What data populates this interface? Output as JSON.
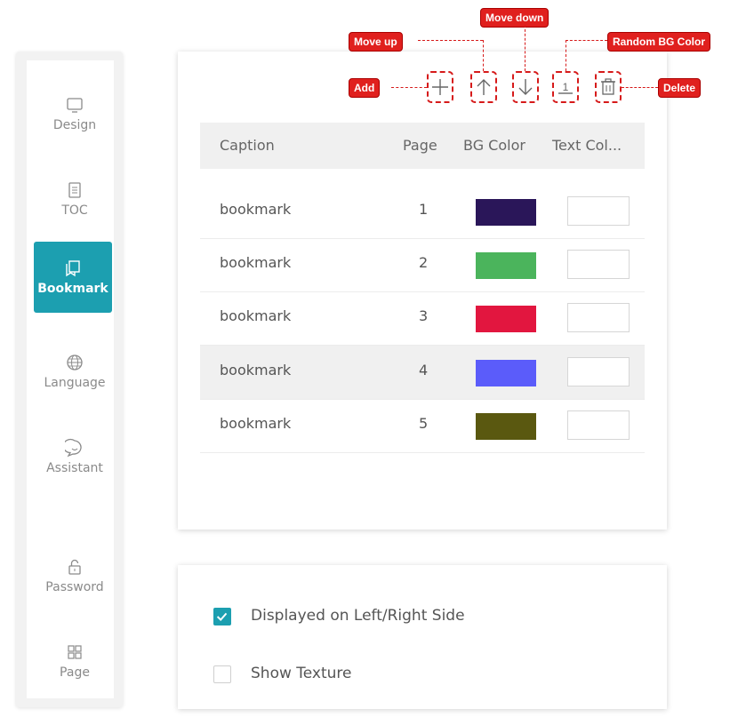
{
  "sidebar": {
    "items": [
      {
        "label": "Design",
        "icon": "monitor-icon"
      },
      {
        "label": "TOC",
        "icon": "document-icon"
      },
      {
        "label": "Bookmark",
        "icon": "bookmark-icon",
        "active": true
      },
      {
        "label": "Language",
        "icon": "globe-icon"
      },
      {
        "label": "Assistant",
        "icon": "chat-icon"
      },
      {
        "label": "Password",
        "icon": "lock-icon"
      },
      {
        "label": "Page",
        "icon": "grid-icon"
      }
    ]
  },
  "toolbar": {
    "callouts": {
      "add": "Add",
      "move_up": "Move up",
      "move_down": "Move down",
      "random_bg": "Random BG Color",
      "delete": "Delete"
    }
  },
  "table": {
    "headers": [
      "Caption",
      "Page",
      "BG Color",
      "Text Col..."
    ],
    "rows": [
      {
        "caption": "bookmark",
        "page": "1",
        "bg": "#2a1659"
      },
      {
        "caption": "bookmark",
        "page": "2",
        "bg": "#4bb45c"
      },
      {
        "caption": "bookmark",
        "page": "3",
        "bg": "#e2163f"
      },
      {
        "caption": "bookmark",
        "page": "4",
        "bg": "#5b5cfa"
      },
      {
        "caption": "bookmark",
        "page": "5",
        "bg": "#5a5810"
      }
    ]
  },
  "options": [
    {
      "label": "Displayed on Left/Right Side",
      "checked": true
    },
    {
      "label": "Show Texture",
      "checked": false
    }
  ],
  "colors": {
    "accent": "#1c9fb0",
    "callout": "#e0201e"
  }
}
